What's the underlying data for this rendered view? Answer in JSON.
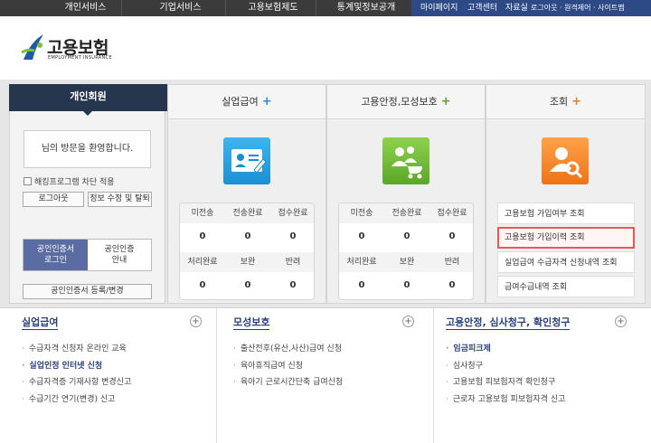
{
  "topnav": {
    "items": [
      "개인서비스",
      "기업서비스",
      "고용보험제도",
      "통계및정보공개"
    ],
    "mypage": "마이페이지",
    "help": "고객센터",
    "data": "자료실",
    "utility": "로그아웃 · 원격제어 · 사이트맵"
  },
  "logo": {
    "title": "고용보험",
    "subtitle": "EMPLOYMENT INSURANCE"
  },
  "login": {
    "header": "개인회원",
    "welcome": "님의 방문을 환영합니다.",
    "hack_block": "해킹프로그램 차단 적용",
    "logout": "로그아웃",
    "edit_info": "정보 수정 및 탈퇴",
    "cert_login_1": "공인인증서",
    "cert_login_2": "로그인",
    "cert_guide_1": "공인인증",
    "cert_guide_2": "안내",
    "cert_register": "공인인증서 등록/변경"
  },
  "col1": {
    "title": "실업급여",
    "plus": "+",
    "stats": [
      {
        "label": "미전송",
        "value": "0"
      },
      {
        "label": "전송완료",
        "value": "0"
      },
      {
        "label": "접수완료",
        "value": "0"
      },
      {
        "label": "처리완료",
        "value": "0"
      },
      {
        "label": "보완",
        "value": "0"
      },
      {
        "label": "반려",
        "value": "0"
      }
    ]
  },
  "col2": {
    "title": "고용안정,모성보호",
    "plus": "+",
    "stats": [
      {
        "label": "미전송",
        "value": "0"
      },
      {
        "label": "전송완료",
        "value": "0"
      },
      {
        "label": "접수완료",
        "value": "0"
      },
      {
        "label": "처리완료",
        "value": "0"
      },
      {
        "label": "보완",
        "value": "0"
      },
      {
        "label": "반려",
        "value": "0"
      }
    ]
  },
  "col3": {
    "title": "조회",
    "plus": "+",
    "menu": [
      "고용보험 가입여부 조회",
      "고용보험 가입이력 조회",
      "실업급여 수급자격 신청내역 조회",
      "급여수급내역 조회"
    ]
  },
  "bottom": {
    "b1": {
      "title": "실업급여",
      "plus": "+",
      "items": [
        "수급자격 신청자 온라인 교육",
        "실업인정 인터넷 신청",
        "수급자격증 기재사항 변경신고",
        "수급기간 연기(변경) 신고"
      ]
    },
    "b2": {
      "title": "모성보호",
      "plus": "+",
      "items": [
        "출산전후(유산,사산)급여 신청",
        "육아휴직급여 신청",
        "육아기 근로시간단축 급여신청"
      ]
    },
    "b3": {
      "title": "고용안정, 심사청구, 확인청구",
      "plus": "+",
      "items": [
        "임금피크제",
        "심사청구",
        "고용보험 피보험자격 확인청구",
        "근로자 고용보험 피보험자격 신고"
      ]
    }
  },
  "colors": {
    "nav_bg": "#3b3b3b",
    "accent_blue": "#2e4a86",
    "highlight": "#e65a5a"
  }
}
